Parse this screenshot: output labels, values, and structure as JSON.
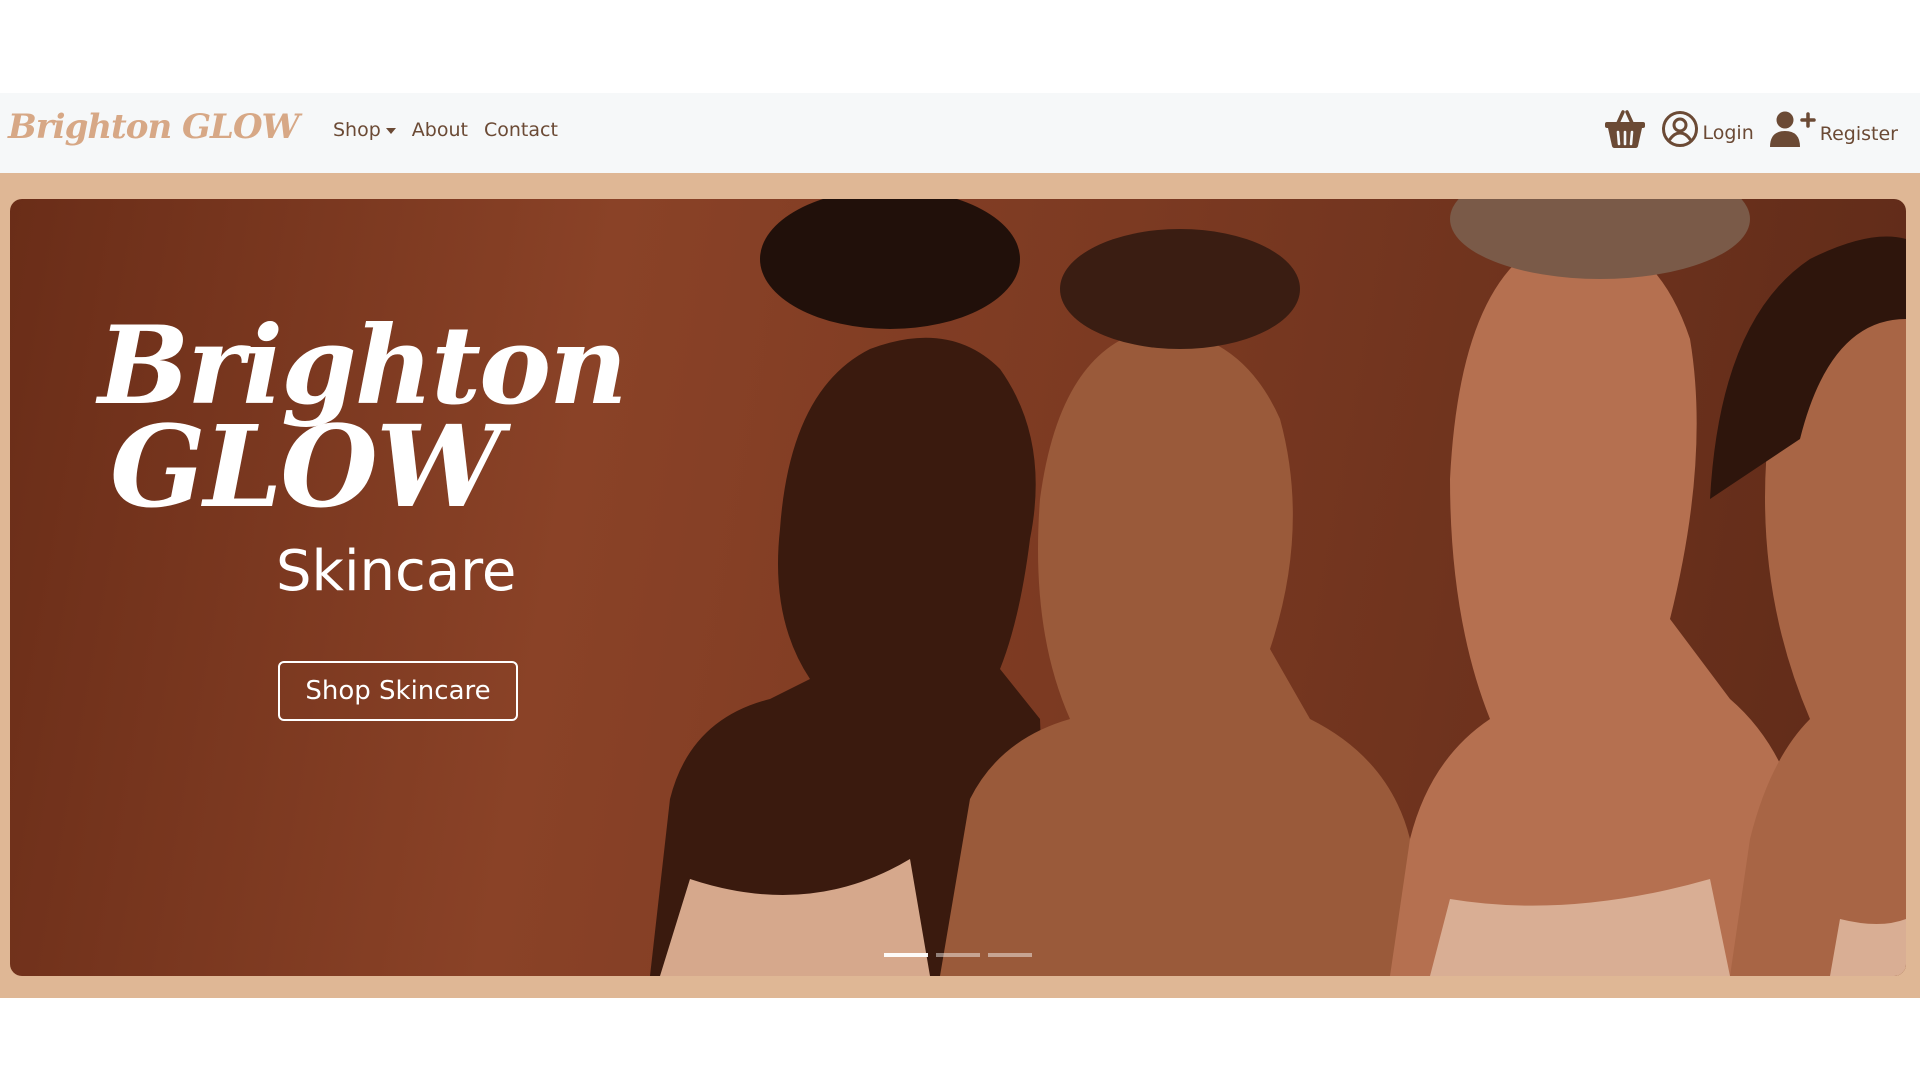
{
  "navbar": {
    "brand": "Brighton GLOW",
    "links": [
      {
        "label": "Shop",
        "has_dropdown": true
      },
      {
        "label": "About"
      },
      {
        "label": "Contact"
      }
    ],
    "cart_icon": "basket-icon",
    "login": {
      "label": "Login",
      "icon": "user-circle-icon"
    },
    "register": {
      "label": "Register",
      "icon": "user-plus-icon"
    }
  },
  "hero": {
    "title_line1": "Brighton",
    "title_line2": "GLOW",
    "subtitle": "Skincare",
    "cta_label": "Shop Skincare",
    "slide_count": 3,
    "active_slide": 1
  },
  "colors": {
    "brand": "#d7a886",
    "nav_text": "#6b4a35",
    "navbar_bg": "#f6f8f9",
    "frame_bg": "#dfb795",
    "hero_bg": "#7c3a22"
  }
}
